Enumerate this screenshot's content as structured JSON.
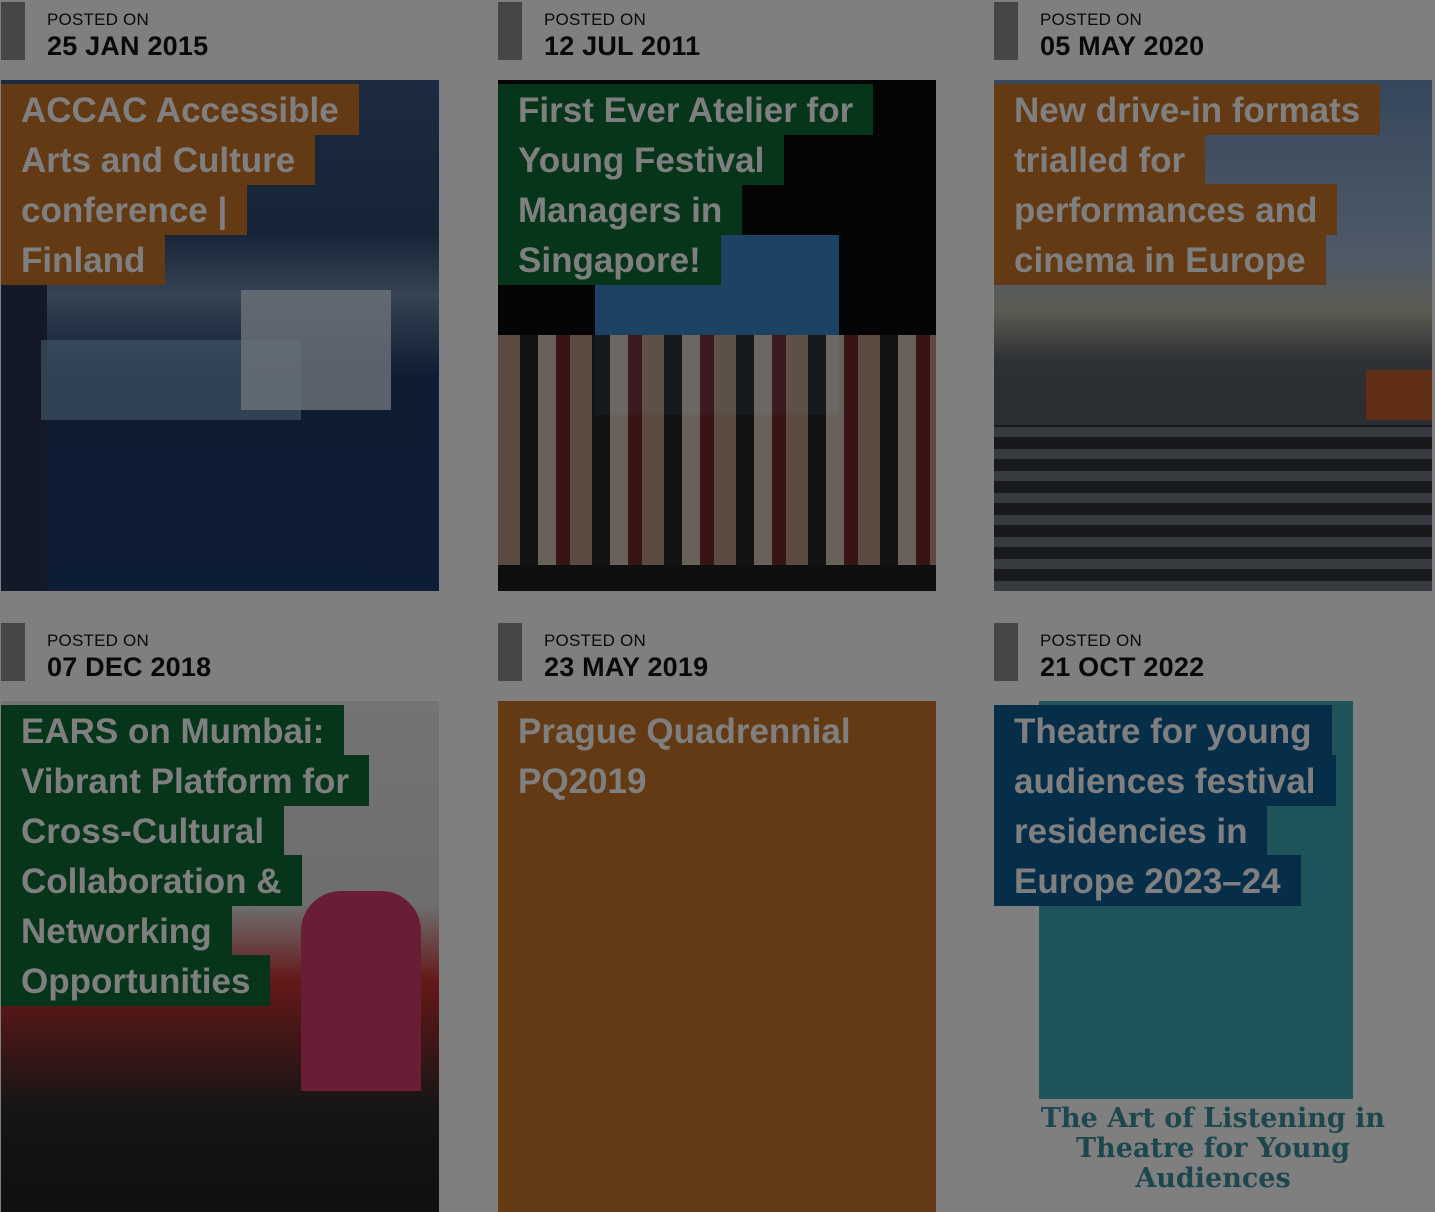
{
  "posts": [
    {
      "posted_label": "POSTED ON",
      "date": "25 JAN 2015",
      "title": "ACCAC Accessible Arts and Culture conference | Finland",
      "title_color": "orange"
    },
    {
      "posted_label": "POSTED ON",
      "date": "12 JUL 2011",
      "title": "First Ever Atelier for Young Festival Managers in Singapore!",
      "title_color": "green"
    },
    {
      "posted_label": "POSTED ON",
      "date": "05 MAY 2020",
      "title": "New drive-in formats trialled for performances and cinema in Europe",
      "title_color": "orange"
    },
    {
      "posted_label": "POSTED ON",
      "date": "07 DEC 2018",
      "title": "EARS on Mumbai: Vibrant Platform for Cross-Cultural Collaboration & Networking Opportunities",
      "title_color": "green"
    },
    {
      "posted_label": "POSTED ON",
      "date": "23 MAY 2019",
      "title": "Prague Quadrennial PQ2019",
      "title_color": "orange"
    },
    {
      "posted_label": "POSTED ON",
      "date": "21 OCT 2022",
      "title": "Theatre for young audiences festival residencies in Europe 2023–24",
      "title_color": "blue",
      "poster_caption": "The Art of Listening in Theatre for Young Audiences"
    }
  ],
  "colors": {
    "orange": "#c87428",
    "green": "#0c6b35",
    "blue": "#0e5d93",
    "overlay": "rgba(0,0,0,0.5)"
  }
}
